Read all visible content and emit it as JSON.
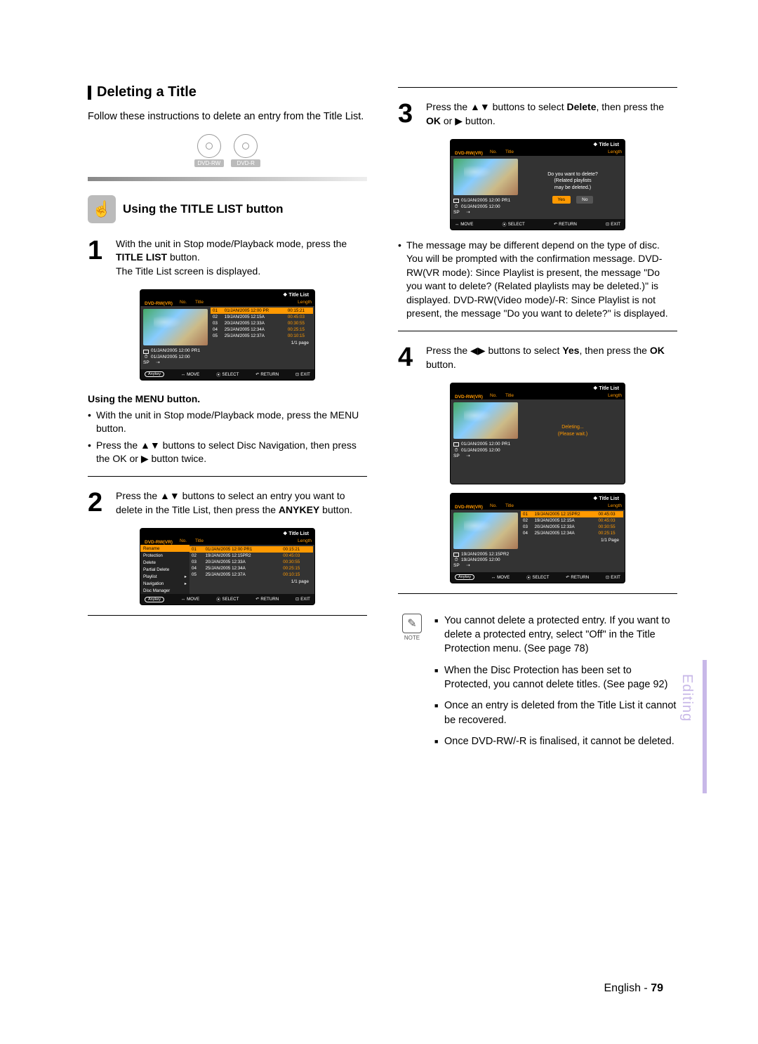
{
  "section_title": "Deleting a Title",
  "intro": "Follow these instructions to delete an entry from the Title List.",
  "disc_labels": [
    "DVD-RW",
    "DVD-R"
  ],
  "using_title": "Using the TITLE LIST button",
  "step1": {
    "pre": "With the unit in Stop mode/Playback mode, press the ",
    "bold": "TITLE LIST",
    "post": " button.",
    "line2": "The Title List screen is displayed."
  },
  "osd_common": {
    "title": "Title List",
    "dvdrw": "DVD-RW(VR)",
    "hdr_no": "No.",
    "hdr_title": "Title",
    "hdr_len": "Length",
    "meta_line1": "01/JAN/2005 12:00 PR1",
    "meta_line2": "01/JAN/2005 12:00",
    "sp": "SP",
    "page": "1/1 page",
    "page_cap": "1/1 Page",
    "anykey": "Anykey",
    "move": "MOVE",
    "select": "SELECT",
    "return": "RETURN",
    "exit": "EXIT"
  },
  "osd1_rows": [
    {
      "no": "01",
      "title": "01/JAN/2005 12:00 PR",
      "len": "00:15:21"
    },
    {
      "no": "02",
      "title": "19/JAN/2005 12:15A",
      "len": "00:45:03"
    },
    {
      "no": "03",
      "title": "20/JAN/2005 12:33A",
      "len": "00:30:55"
    },
    {
      "no": "04",
      "title": "25/JAN/2005 12:34A",
      "len": "00:25:15"
    },
    {
      "no": "05",
      "title": "25/JAN/2005 12:37A",
      "len": "00:10:15"
    }
  ],
  "menu_sub": {
    "heading": "Using the MENU button.",
    "b1_pre": "With the unit in Stop mode/Playback mode, press the ",
    "b1_bold": "MENU",
    "b1_post": " button.",
    "b2_pre": "Press the ",
    "b2_mid1": " buttons to select ",
    "b2_bold1": "Disc Navigation",
    "b2_mid2": ", then press the ",
    "b2_bold2": "OK",
    "b2_mid3": " or ",
    "b2_post": " button twice."
  },
  "step2": {
    "pre": "Press the ",
    "mid": " buttons to select an entry you want to delete in the Title List, then press the ",
    "bold": "ANYKEY",
    "post": " button."
  },
  "osd2_menu": [
    "Rename",
    "Protection",
    "Delete",
    "Partial Delete",
    "Playlist",
    "Navigation",
    "Disc Manager"
  ],
  "osd2_menu_arrow": [
    "Playlist",
    "Navigation"
  ],
  "osd2_rows": [
    {
      "no": "01",
      "title": "01/JAN/2005 12:00 PR1",
      "len": "00:15:21"
    },
    {
      "no": "02",
      "title": "19/JAN/2005 12:15PR2",
      "len": "00:45:03"
    },
    {
      "no": "03",
      "title": "20/JAN/2005 12:33A",
      "len": "00:30:55"
    },
    {
      "no": "04",
      "title": "25/JAN/2005 12:34A",
      "len": "00:25:15"
    },
    {
      "no": "05",
      "title": "25/JAN/2005 12:37A",
      "len": "00:10:15"
    }
  ],
  "step3": {
    "pre": "Press the ",
    "mid1": " buttons to select ",
    "bold1": "Delete",
    "mid2": ", then press the ",
    "bold2": "OK",
    "mid3": " or ",
    "post": " button."
  },
  "osd3": {
    "line1": "Do you want to delete?",
    "line2": "(Related playlists",
    "line3": "may be deleted.)",
    "yes": "Yes",
    "no": "No"
  },
  "step3_bullet": "The message may be different depend on the type of disc. You will be prompted with the confirmation message. DVD-RW(VR mode): Since Playlist is present, the message \"Do you want to delete? (Related playlists may be deleted.)\" is displayed. DVD-RW(Video mode)/-R: Since Playlist is not present, the message \"Do you want to delete?\" is displayed.",
  "step4": {
    "pre": "Press the ",
    "mid1": " buttons to select ",
    "bold1": "Yes",
    "mid2": ", then press the ",
    "bold2": "OK",
    "post": " button."
  },
  "osd4": {
    "line1": "Deleting...",
    "line2": "(Please wait.)"
  },
  "osd5_meta1": "19/JAN/2005 12:15PR2",
  "osd5_meta2": "19/JAN/2005 12:00",
  "osd5_rows": [
    {
      "no": "01",
      "title": "19/JAN/2005 12:15PR2",
      "len": "00:45:03"
    },
    {
      "no": "02",
      "title": "19/JAN/2005 12:15A",
      "len": "00:45:03"
    },
    {
      "no": "03",
      "title": "20/JAN/2005 12:33A",
      "len": "00:30:55"
    },
    {
      "no": "04",
      "title": "25/JAN/2005 12:34A",
      "len": "00:25:15"
    }
  ],
  "note_label": "NOTE",
  "notes": [
    "You cannot delete a protected entry. If you want to delete a protected entry, select \"Off\" in the Title Protection menu. (See page 78)",
    "When the Disc Protection has been set to Protected, you cannot delete titles. (See page 92)",
    "Once an entry is deleted from the Title List it cannot be recovered.",
    "Once DVD-RW/-R is finalised, it cannot be deleted."
  ],
  "side_tab": "Editing",
  "footer_lang": "English - ",
  "footer_page": "79"
}
